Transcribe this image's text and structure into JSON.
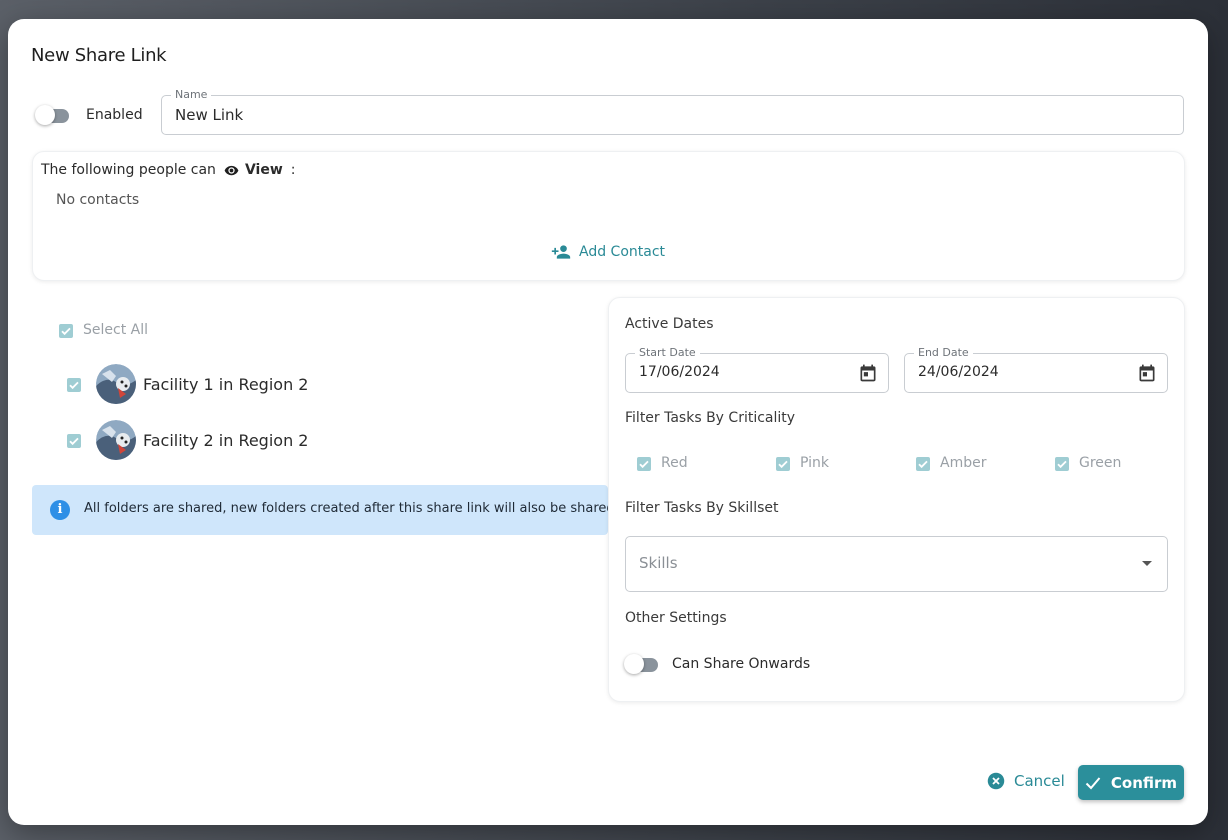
{
  "dialog": {
    "title": "New Share Link",
    "enabled_label": "Enabled",
    "name_field": {
      "label": "Name",
      "value": "New Link"
    }
  },
  "people": {
    "prefix": "The following people can",
    "permission": "View",
    "colon": ":",
    "empty": "No contacts",
    "add_contact": "Add Contact"
  },
  "folders": {
    "select_all": "Select All",
    "items": [
      {
        "label": "Facility 1 in Region 2",
        "checked": true
      },
      {
        "label": "Facility 2 in Region 2",
        "checked": true
      }
    ],
    "info": "All folders are shared, new folders created after this share link will also be shared"
  },
  "settings": {
    "active_dates_label": "Active Dates",
    "start_date": {
      "label": "Start Date",
      "value": "17/06/2024"
    },
    "end_date": {
      "label": "End Date",
      "value": "24/06/2024"
    },
    "criticality_label": "Filter Tasks By Criticality",
    "criticality": [
      "Red",
      "Pink",
      "Amber",
      "Green"
    ],
    "skillset_label": "Filter Tasks By Skillset",
    "skills_placeholder": "Skills",
    "other_label": "Other Settings",
    "share_onwards_label": "Can Share Onwards"
  },
  "actions": {
    "cancel": "Cancel",
    "confirm": "Confirm"
  },
  "colors": {
    "accent": "#2b8f9b",
    "info_bg": "#cfe6fb",
    "checkbox": "#9fcdd3"
  }
}
